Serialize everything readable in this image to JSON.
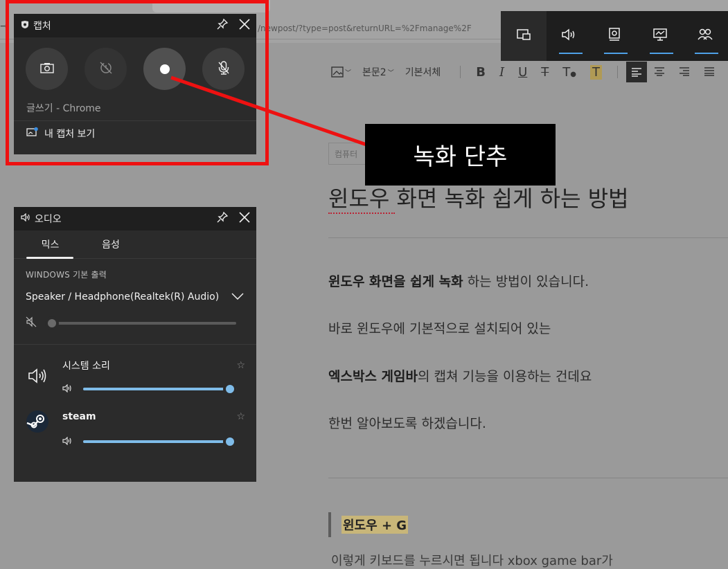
{
  "browser": {
    "url": "/newpost/?type=post&returnURL=%2Fmanage%2F"
  },
  "editor": {
    "toolbar": {
      "style_label": "본문2",
      "font_label": "기본서체"
    },
    "category_placeholder": "컴퓨터",
    "post_title": "윈도우 화면 녹화 쉽게 하는 방법",
    "paragraphs": [
      {
        "bold": "윈도우 화면을 쉽게 녹화",
        "text": " 하는 방법이 있습니다."
      },
      {
        "bold": "",
        "text": "바로 윈도우에 기본적으로 설치되어 있는"
      },
      {
        "bold": "엑스박스 게임바",
        "text": "의 캡쳐 기능을 이용하는 건데요"
      },
      {
        "bold": "",
        "text": "한번 알아보도록 하겠습니다."
      }
    ],
    "quote": "윈도우 + G",
    "cut_text": "이렇게 키보드를 누르시면 됩니다 xbox game bar가"
  },
  "gamebar": {
    "buttons": [
      {
        "name": "widget-menu-icon",
        "active": false
      },
      {
        "name": "audio-icon",
        "active": true
      },
      {
        "name": "capture-icon",
        "active": true
      },
      {
        "name": "performance-icon",
        "active": true
      },
      {
        "name": "social-icon",
        "active": true
      }
    ],
    "accent": "#4ea1e8"
  },
  "capture_panel": {
    "title": "캡처",
    "buttons": [
      "screenshot-camera-icon",
      "record-last-icon",
      "record-start-icon",
      "mic-off-icon"
    ],
    "app_label": "글쓰기 - Chrome",
    "gallery_link": "내 캡처 보기"
  },
  "callout": {
    "label": "녹화 단추",
    "color": "#ee1111"
  },
  "audio_panel": {
    "title": "오디오",
    "tabs": [
      "믹스",
      "음성"
    ],
    "section_caption": "WINDOWS 기본 출력",
    "device": "Speaker / Headphone(Realtek(R) Audio)",
    "master_volume": 0.0,
    "apps": [
      {
        "name": "시스템 소리",
        "volume": 1.0
      },
      {
        "name": "steam",
        "volume": 1.0
      }
    ],
    "slider_color": "#7fbce9"
  }
}
